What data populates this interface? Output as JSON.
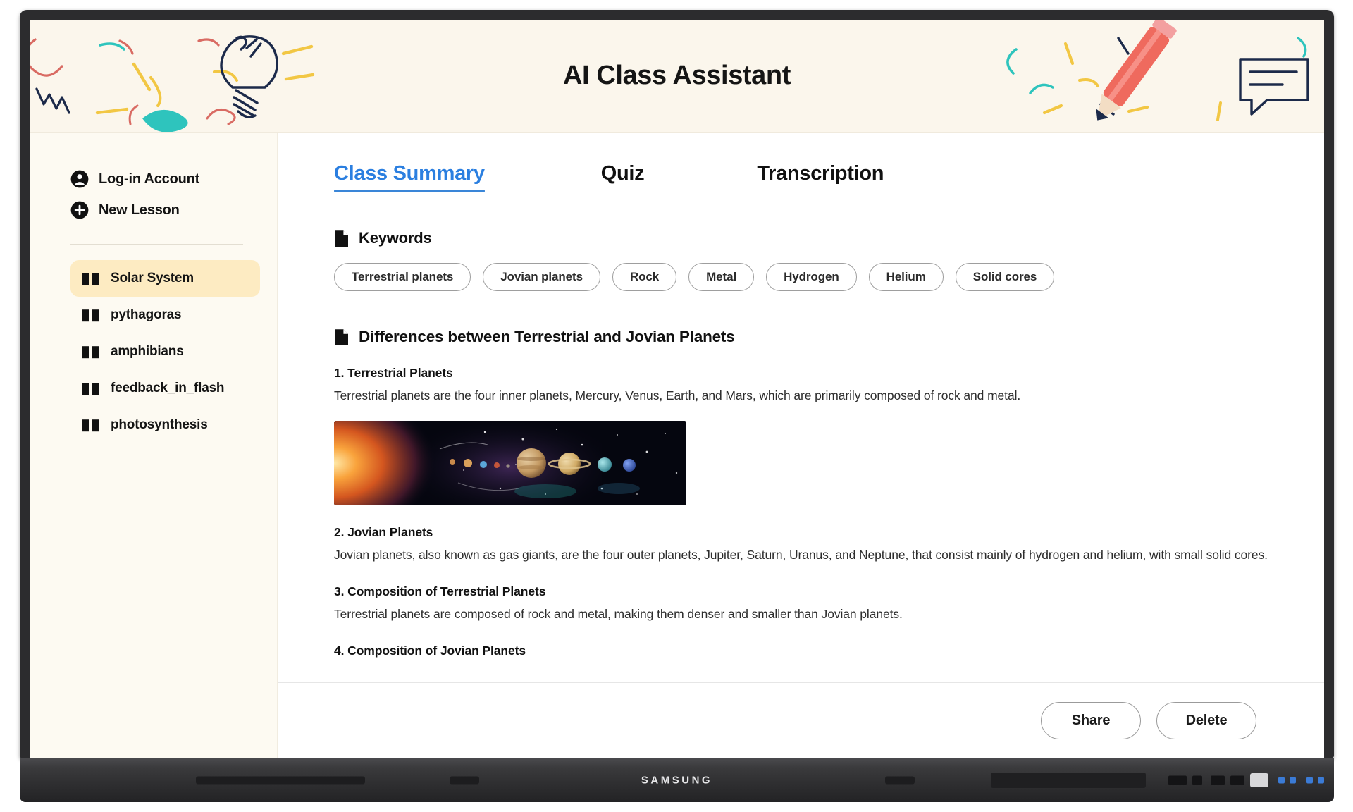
{
  "header": {
    "title": "AI Class Assistant",
    "doodle_colors": {
      "yellow": "#f2c744",
      "teal": "#2ec4bd",
      "red": "#e0655f",
      "navy": "#1c2a4a",
      "pencil": "#ef6a5e"
    },
    "background": "#fbf6ec"
  },
  "sidebar": {
    "background": "#fdfaf2",
    "active_highlight": "#fdebc2",
    "top_items": [
      {
        "label": "Log-in Account",
        "icon": "account-circle-icon"
      },
      {
        "label": "New Lesson",
        "icon": "plus-circle-icon"
      }
    ],
    "lessons": [
      {
        "label": "Solar System",
        "icon": "book-icon",
        "active": true
      },
      {
        "label": "pythagoras",
        "icon": "book-icon",
        "active": false
      },
      {
        "label": "amphibians",
        "icon": "book-icon",
        "active": false
      },
      {
        "label": "feedback_in_flash",
        "icon": "book-icon",
        "active": false
      },
      {
        "label": "photosynthesis",
        "icon": "book-icon",
        "active": false
      }
    ]
  },
  "main": {
    "tabs": [
      {
        "label": "Class Summary",
        "active": true
      },
      {
        "label": "Quiz",
        "active": false
      },
      {
        "label": "Transcription",
        "active": false
      }
    ],
    "active_tab_color": "#2b7fe0",
    "keywords_section": {
      "icon": "document-icon",
      "title": "Keywords",
      "chips": [
        "Terrestrial planets",
        "Jovian planets",
        "Rock",
        "Metal",
        "Hydrogen",
        "Helium",
        "Solid cores"
      ]
    },
    "summary_section": {
      "icon": "document-icon",
      "title": "Differences between Terrestrial and Jovian Planets",
      "items": [
        {
          "heading": "1. Terrestrial Planets",
          "body": "Terrestrial planets are the four inner planets, Mercury, Venus, Earth, and Mars, which are primarily composed of rock and metal.",
          "has_image": true,
          "image_alt": "solar-system-planets-image"
        },
        {
          "heading": "2. Jovian Planets",
          "body": "Jovian planets, also known as gas giants, are the four outer planets, Jupiter, Saturn, Uranus, and Neptune, that consist mainly of hydrogen and helium, with small solid cores.",
          "has_image": false
        },
        {
          "heading": "3. Composition of Terrestrial Planets",
          "body": "Terrestrial planets are composed of rock and metal, making them denser and smaller than Jovian planets.",
          "has_image": false
        },
        {
          "heading": "4. Composition of Jovian Planets",
          "body": "",
          "has_image": false
        }
      ]
    }
  },
  "footer": {
    "share_label": "Share",
    "delete_label": "Delete"
  },
  "device": {
    "brand": "SAMSUNG"
  }
}
